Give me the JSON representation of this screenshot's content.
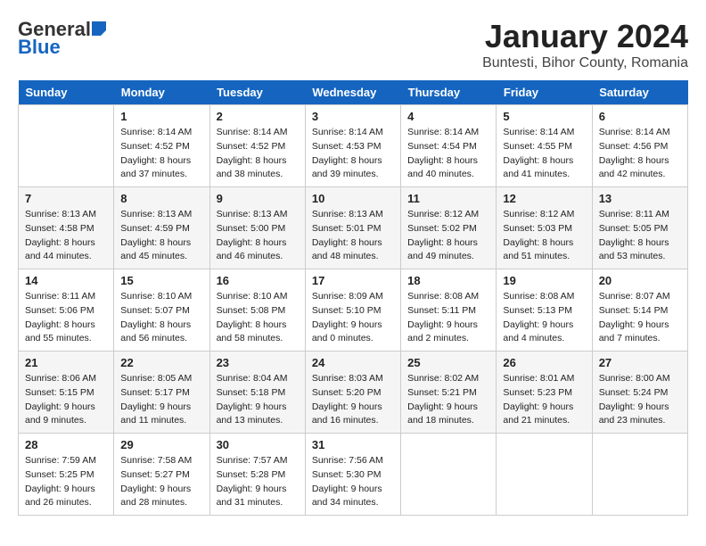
{
  "logo": {
    "general": "General",
    "blue": "Blue"
  },
  "title": "January 2024",
  "subtitle": "Buntesti, Bihor County, Romania",
  "weekdays": [
    "Sunday",
    "Monday",
    "Tuesday",
    "Wednesday",
    "Thursday",
    "Friday",
    "Saturday"
  ],
  "weeks": [
    [
      {
        "day": "",
        "info": ""
      },
      {
        "day": "1",
        "info": "Sunrise: 8:14 AM\nSunset: 4:52 PM\nDaylight: 8 hours\nand 37 minutes."
      },
      {
        "day": "2",
        "info": "Sunrise: 8:14 AM\nSunset: 4:52 PM\nDaylight: 8 hours\nand 38 minutes."
      },
      {
        "day": "3",
        "info": "Sunrise: 8:14 AM\nSunset: 4:53 PM\nDaylight: 8 hours\nand 39 minutes."
      },
      {
        "day": "4",
        "info": "Sunrise: 8:14 AM\nSunset: 4:54 PM\nDaylight: 8 hours\nand 40 minutes."
      },
      {
        "day": "5",
        "info": "Sunrise: 8:14 AM\nSunset: 4:55 PM\nDaylight: 8 hours\nand 41 minutes."
      },
      {
        "day": "6",
        "info": "Sunrise: 8:14 AM\nSunset: 4:56 PM\nDaylight: 8 hours\nand 42 minutes."
      }
    ],
    [
      {
        "day": "7",
        "info": "Sunrise: 8:13 AM\nSunset: 4:58 PM\nDaylight: 8 hours\nand 44 minutes."
      },
      {
        "day": "8",
        "info": "Sunrise: 8:13 AM\nSunset: 4:59 PM\nDaylight: 8 hours\nand 45 minutes."
      },
      {
        "day": "9",
        "info": "Sunrise: 8:13 AM\nSunset: 5:00 PM\nDaylight: 8 hours\nand 46 minutes."
      },
      {
        "day": "10",
        "info": "Sunrise: 8:13 AM\nSunset: 5:01 PM\nDaylight: 8 hours\nand 48 minutes."
      },
      {
        "day": "11",
        "info": "Sunrise: 8:12 AM\nSunset: 5:02 PM\nDaylight: 8 hours\nand 49 minutes."
      },
      {
        "day": "12",
        "info": "Sunrise: 8:12 AM\nSunset: 5:03 PM\nDaylight: 8 hours\nand 51 minutes."
      },
      {
        "day": "13",
        "info": "Sunrise: 8:11 AM\nSunset: 5:05 PM\nDaylight: 8 hours\nand 53 minutes."
      }
    ],
    [
      {
        "day": "14",
        "info": "Sunrise: 8:11 AM\nSunset: 5:06 PM\nDaylight: 8 hours\nand 55 minutes."
      },
      {
        "day": "15",
        "info": "Sunrise: 8:10 AM\nSunset: 5:07 PM\nDaylight: 8 hours\nand 56 minutes."
      },
      {
        "day": "16",
        "info": "Sunrise: 8:10 AM\nSunset: 5:08 PM\nDaylight: 8 hours\nand 58 minutes."
      },
      {
        "day": "17",
        "info": "Sunrise: 8:09 AM\nSunset: 5:10 PM\nDaylight: 9 hours\nand 0 minutes."
      },
      {
        "day": "18",
        "info": "Sunrise: 8:08 AM\nSunset: 5:11 PM\nDaylight: 9 hours\nand 2 minutes."
      },
      {
        "day": "19",
        "info": "Sunrise: 8:08 AM\nSunset: 5:13 PM\nDaylight: 9 hours\nand 4 minutes."
      },
      {
        "day": "20",
        "info": "Sunrise: 8:07 AM\nSunset: 5:14 PM\nDaylight: 9 hours\nand 7 minutes."
      }
    ],
    [
      {
        "day": "21",
        "info": "Sunrise: 8:06 AM\nSunset: 5:15 PM\nDaylight: 9 hours\nand 9 minutes."
      },
      {
        "day": "22",
        "info": "Sunrise: 8:05 AM\nSunset: 5:17 PM\nDaylight: 9 hours\nand 11 minutes."
      },
      {
        "day": "23",
        "info": "Sunrise: 8:04 AM\nSunset: 5:18 PM\nDaylight: 9 hours\nand 13 minutes."
      },
      {
        "day": "24",
        "info": "Sunrise: 8:03 AM\nSunset: 5:20 PM\nDaylight: 9 hours\nand 16 minutes."
      },
      {
        "day": "25",
        "info": "Sunrise: 8:02 AM\nSunset: 5:21 PM\nDaylight: 9 hours\nand 18 minutes."
      },
      {
        "day": "26",
        "info": "Sunrise: 8:01 AM\nSunset: 5:23 PM\nDaylight: 9 hours\nand 21 minutes."
      },
      {
        "day": "27",
        "info": "Sunrise: 8:00 AM\nSunset: 5:24 PM\nDaylight: 9 hours\nand 23 minutes."
      }
    ],
    [
      {
        "day": "28",
        "info": "Sunrise: 7:59 AM\nSunset: 5:25 PM\nDaylight: 9 hours\nand 26 minutes."
      },
      {
        "day": "29",
        "info": "Sunrise: 7:58 AM\nSunset: 5:27 PM\nDaylight: 9 hours\nand 28 minutes."
      },
      {
        "day": "30",
        "info": "Sunrise: 7:57 AM\nSunset: 5:28 PM\nDaylight: 9 hours\nand 31 minutes."
      },
      {
        "day": "31",
        "info": "Sunrise: 7:56 AM\nSunset: 5:30 PM\nDaylight: 9 hours\nand 34 minutes."
      },
      {
        "day": "",
        "info": ""
      },
      {
        "day": "",
        "info": ""
      },
      {
        "day": "",
        "info": ""
      }
    ]
  ]
}
